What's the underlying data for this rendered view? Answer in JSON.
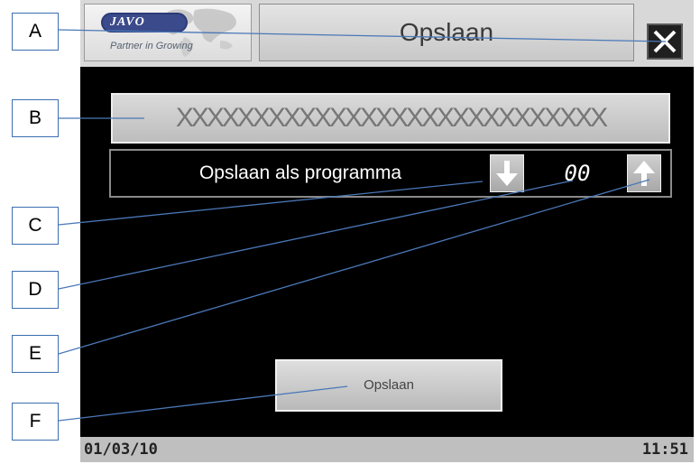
{
  "header": {
    "logo_brand": "JAVO",
    "logo_tagline": "Partner in Growing",
    "title": "Opslaan",
    "close_icon": "close-icon"
  },
  "form": {
    "name_value": "XXXXXXXXXXXXXXXXXXXXXXXXXXXX",
    "program_label": "Opslaan als programma",
    "program_number": "00",
    "down_icon": "arrow-down-icon",
    "up_icon": "arrow-up-icon",
    "save_label": "Opslaan"
  },
  "status": {
    "date": "01/03/10",
    "time": "11:51"
  },
  "callouts": [
    "A",
    "B",
    "C",
    "D",
    "E",
    "F"
  ],
  "colors": {
    "screen_background": "#000000",
    "panel_gray": "#c8c8c8",
    "callout_border": "#3c6fb0",
    "logo_blue": "#3b4a8a"
  }
}
